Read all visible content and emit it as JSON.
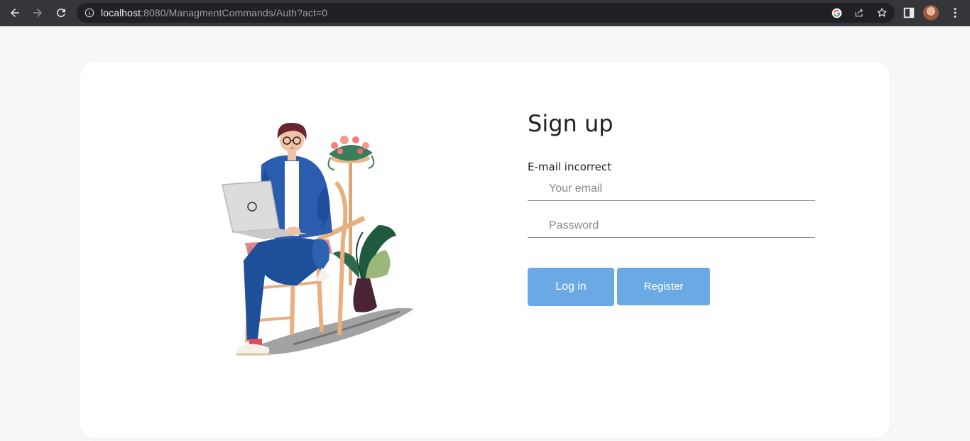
{
  "browser": {
    "url_host": "localhost",
    "url_rest": ":8080/ManagmentCommands/Auth?act=0"
  },
  "form": {
    "title": "Sign up",
    "error": "E-mail incorrect",
    "email_placeholder": "Your email",
    "email_value": "",
    "password_placeholder": "Password",
    "password_value": "",
    "login_label": "Log in",
    "register_label": "Register"
  },
  "colors": {
    "button": "#6aa9e3",
    "card": "#ffffff",
    "page_bg": "#f7f7f7",
    "chrome_bg": "#35363a"
  },
  "icons": {
    "back": "back-arrow-icon",
    "forward": "forward-arrow-icon",
    "reload": "reload-icon",
    "info": "info-icon",
    "google": "google-icon",
    "share": "share-icon",
    "bookmark": "star-icon",
    "sidebar": "side-panel-icon",
    "menu": "kebab-menu-icon"
  }
}
